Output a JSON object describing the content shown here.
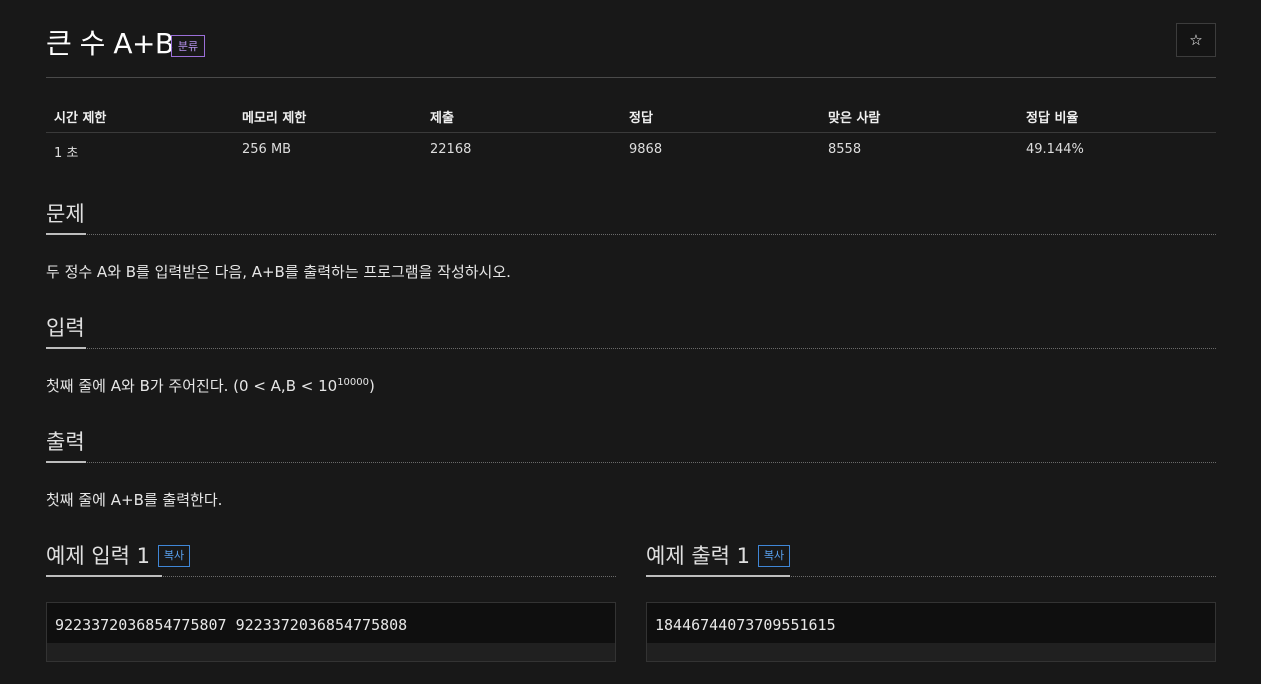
{
  "problem": {
    "title": "큰 수 A+B",
    "category_label": "분류",
    "star_icon": "star-icon"
  },
  "stats": {
    "headers": [
      "시간 제한",
      "메모리 제한",
      "제출",
      "정답",
      "맞은 사람",
      "정답 비율"
    ],
    "values": [
      "1 초",
      "256 MB",
      "22168",
      "9868",
      "8558",
      "49.144%"
    ]
  },
  "sections": {
    "problem": {
      "title": "문제",
      "text": "두 정수 A와 B를 입력받은 다음, A+B를 출력하는 프로그램을 작성하시오."
    },
    "input": {
      "title": "입력",
      "text_before": "첫째 줄에 A와 B가 주어진다. (0 < A,B < 10",
      "superscript": "10000",
      "text_after": ")"
    },
    "output": {
      "title": "출력",
      "text": "첫째 줄에 A+B를 출력한다."
    }
  },
  "examples": {
    "input": {
      "title": "예제 입력 1",
      "copy_label": "복사",
      "content": "9223372036854775807 9223372036854775808"
    },
    "output": {
      "title": "예제 출력 1",
      "copy_label": "복사",
      "content": "18446744073709551615"
    }
  },
  "colors": {
    "background": "#181818",
    "category_badge": "#9b6fd8",
    "copy_badge": "#3f86d6"
  }
}
